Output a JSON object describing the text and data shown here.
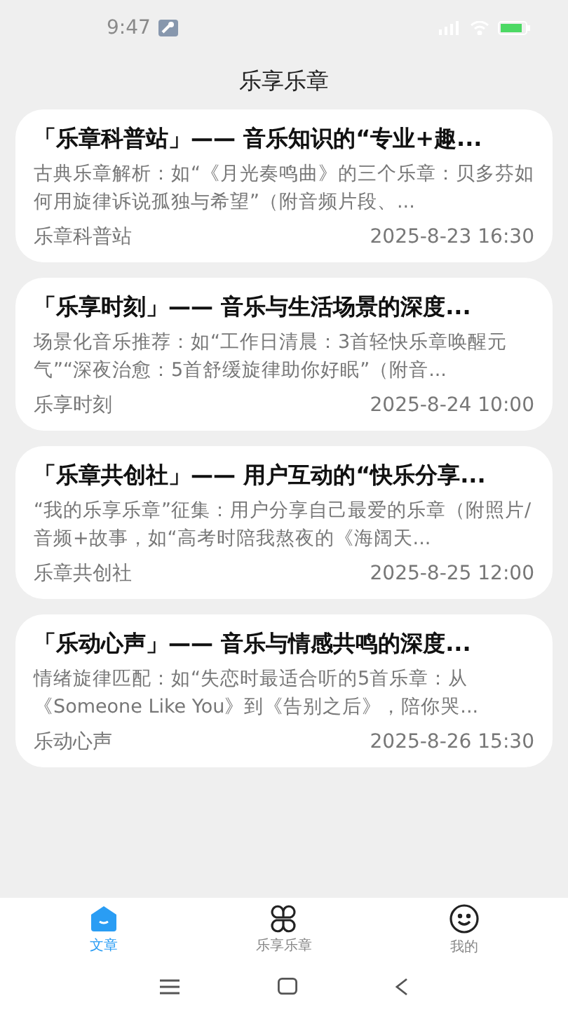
{
  "status_bar": {
    "time": "9:47"
  },
  "header": {
    "title": "乐享乐章"
  },
  "articles": [
    {
      "title": "「乐章科普站」—— 音乐知识的“专业+趣...",
      "excerpt": "古典乐章解析：如“《月光奏鸣曲》的三个乐章：贝多芬如何用旋律诉说孤独与希望”（附音频片段、...",
      "source": "乐章科普站",
      "time": "2025-8-23 16:30"
    },
    {
      "title": "「乐享时刻」—— 音乐与生活场景的深度...",
      "excerpt": "场景化音乐推荐：如“工作日清晨：3首轻快乐章唤醒元气”“深夜治愈：5首舒缓旋律助你好眠”（附音...",
      "source": "乐享时刻",
      "time": "2025-8-24 10:00"
    },
    {
      "title": "「乐章共创社」—— 用户互动的“快乐分享...",
      "excerpt": "“我的乐享乐章”征集：用户分享自己最爱的乐章（附照片/音频+故事，如“高考时陪我熬夜的《海阔天...",
      "source": "乐章共创社",
      "time": "2025-8-25 12:00"
    },
    {
      "title": "「乐动心声」—— 音乐与情感共鸣的深度...",
      "excerpt": "情绪旋律匹配：如“失恋时最适合听的5首乐章：从《Someone Like You》到《告别之后》，陪你哭...",
      "source": "乐动心声",
      "time": "2025-8-26 15:30"
    }
  ],
  "tab_bar": [
    {
      "kind": "home",
      "label": "文章",
      "selected": true
    },
    {
      "kind": "grid",
      "label": "乐享乐章",
      "selected": false
    },
    {
      "kind": "profile",
      "label": "我的",
      "selected": false
    }
  ]
}
